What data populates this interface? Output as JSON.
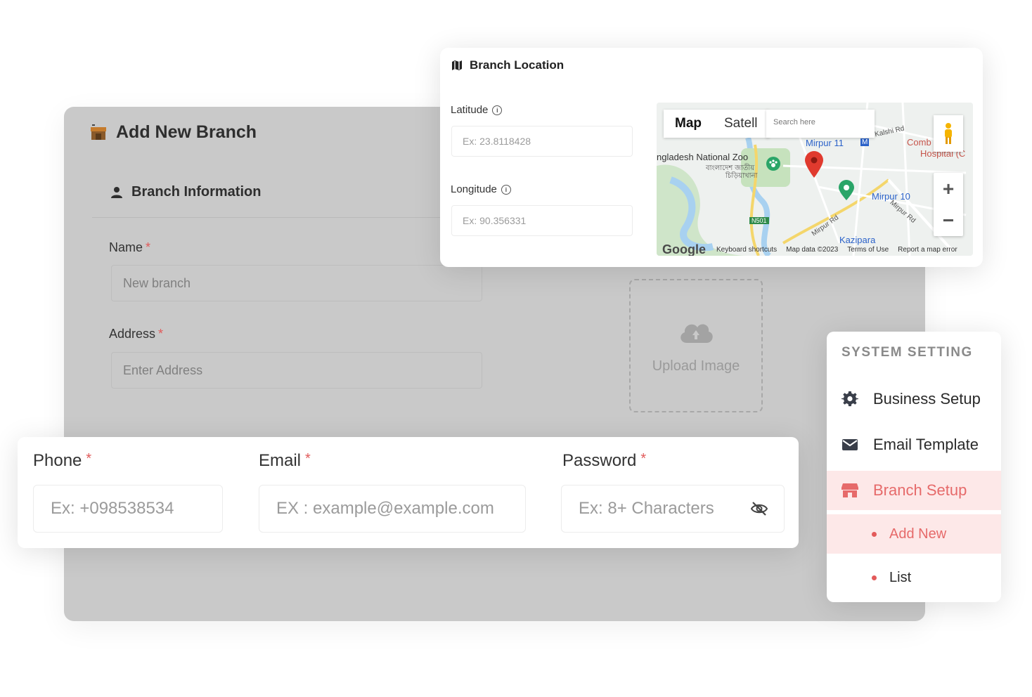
{
  "add_branch": {
    "title": "Add New Branch",
    "section_title": "Branch Information",
    "name_label": "Name",
    "name_value": "New branch",
    "address_label": "Address",
    "address_placeholder": "Enter Address",
    "required_mark": "*",
    "upload_label": "Upload Image"
  },
  "location": {
    "title": "Branch Location",
    "latitude_label": "Latitude",
    "latitude_placeholder": "Ex: 23.8118428",
    "longitude_label": "Longitude",
    "longitude_placeholder": "Ex: 90.356331",
    "map": {
      "tab_map": "Map",
      "tab_satellite": "Satell",
      "search_placeholder": "Search here",
      "labels": {
        "zoo": "ngladesh National Zoo",
        "zoo_bn": "বাংলাদেশ জাতীয়",
        "zoo_bn2": "চিড়িয়াখানা",
        "mirpur11": "Mirpur 11",
        "mirpur10": "Mirpur 10",
        "kazipara": "Kazipara",
        "combined": "Comb",
        "hospital": "Hospital (C",
        "kalshi": "Kalshi Rd",
        "mirpur_rd": "Mirpur Rd",
        "mirpur_rd2": "Mirpur Rd",
        "n501": "N501",
        "letter_m": "M"
      },
      "footer": {
        "google": "Google",
        "shortcuts": "Keyboard shortcuts",
        "map_data": "Map data ©2023",
        "terms": "Terms of Use",
        "report": "Report a map error"
      },
      "zoom_in": "+",
      "zoom_out": "−"
    }
  },
  "contact": {
    "phone_label": "Phone",
    "phone_placeholder": "Ex: +098538534",
    "email_label": "Email",
    "email_placeholder": "EX : example@example.com",
    "password_label": "Password",
    "password_placeholder": "Ex: 8+ Characters",
    "required_mark": "*"
  },
  "settings": {
    "heading": "SYSTEM SETTING",
    "items": [
      {
        "label": "Business Setup",
        "icon": "gear-icon"
      },
      {
        "label": "Email Template",
        "icon": "envelope-icon"
      },
      {
        "label": "Branch Setup",
        "icon": "store-icon",
        "active": true
      }
    ],
    "sub_items": [
      {
        "label": "Add New",
        "active": true
      },
      {
        "label": "List"
      }
    ]
  },
  "colors": {
    "accent": "#e66a6a",
    "active_bg": "#fde8e8",
    "required": "#e15a5a",
    "overlay_grey": "#c9c9c9"
  }
}
